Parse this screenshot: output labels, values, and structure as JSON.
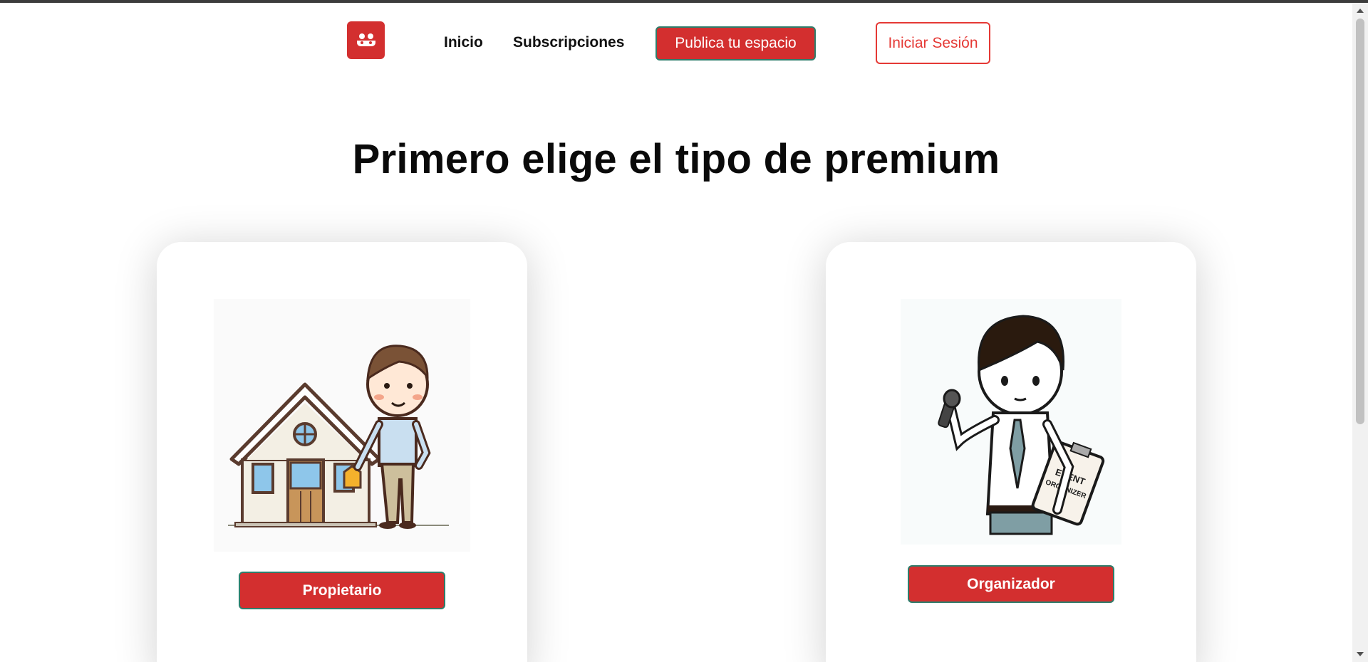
{
  "header": {
    "logo_icon": "people-icon",
    "nav": [
      {
        "label": "Inicio"
      },
      {
        "label": "Subscripciones"
      }
    ],
    "publish_button": "Publica tu espacio",
    "login_button": "Iniciar Sesión"
  },
  "main": {
    "title": "Primero elige el tipo de premium",
    "cards": [
      {
        "button": "Propietario",
        "illustration": "homeowner-illustration"
      },
      {
        "button": "Organizador",
        "illustration": "event-organizer-illustration",
        "clipboard_text": [
          "EVENT",
          "ORGANIZER"
        ]
      }
    ]
  },
  "colors": {
    "brand": "#d32f2f",
    "login_border": "#e53935",
    "button_border": "#2e7d6b"
  }
}
